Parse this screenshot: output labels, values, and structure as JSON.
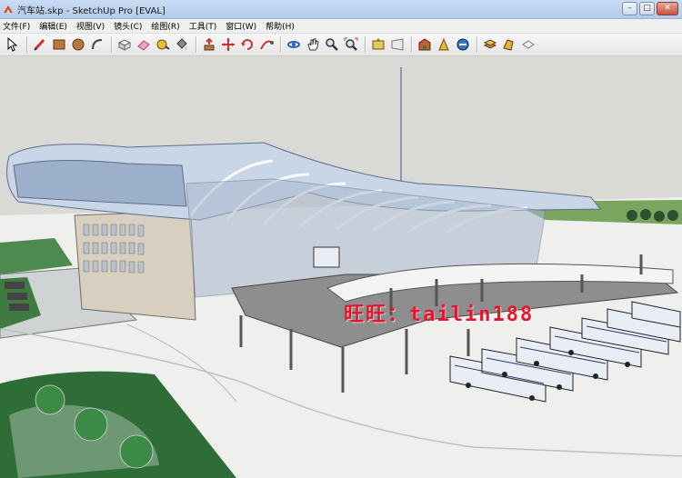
{
  "window": {
    "title": "汽车站.skp - SketchUp Pro [EVAL]"
  },
  "menu": {
    "items": [
      "文件(F)",
      "编辑(E)",
      "视图(V)",
      "镜头(C)",
      "绘图(R)",
      "工具(T)",
      "窗口(W)",
      "帮助(H)"
    ]
  },
  "toolbar": {
    "groups": [
      [
        "select-icon"
      ],
      [
        "pencil-line-icon",
        "rectangle-icon",
        "circle-icon",
        "arc-icon"
      ],
      [
        "make-component-icon",
        "eraser-icon",
        "tape-measure-icon",
        "paint-bucket-icon"
      ],
      [
        "push-pull-icon",
        "move-icon",
        "rotate-icon",
        "follow-me-icon"
      ],
      [
        "orbit-icon",
        "pan-icon",
        "zoom-icon",
        "zoom-extents-icon"
      ],
      [
        "get-models-icon",
        "share-model-icon"
      ],
      [
        "warehouse-icon",
        "component-icon",
        "extension-icon"
      ],
      [
        "layer-icon",
        "materials-icon",
        "styles-icon"
      ]
    ]
  },
  "viewport": {
    "model": "bus-station-3d-model",
    "colors": {
      "sky": "#d9d9d6",
      "ground": "#f0f0ee",
      "grass": "#3d7a45",
      "roof": "#c9d6e8",
      "bus": "#e9eef6"
    },
    "watermark": "旺旺：tailin188"
  }
}
